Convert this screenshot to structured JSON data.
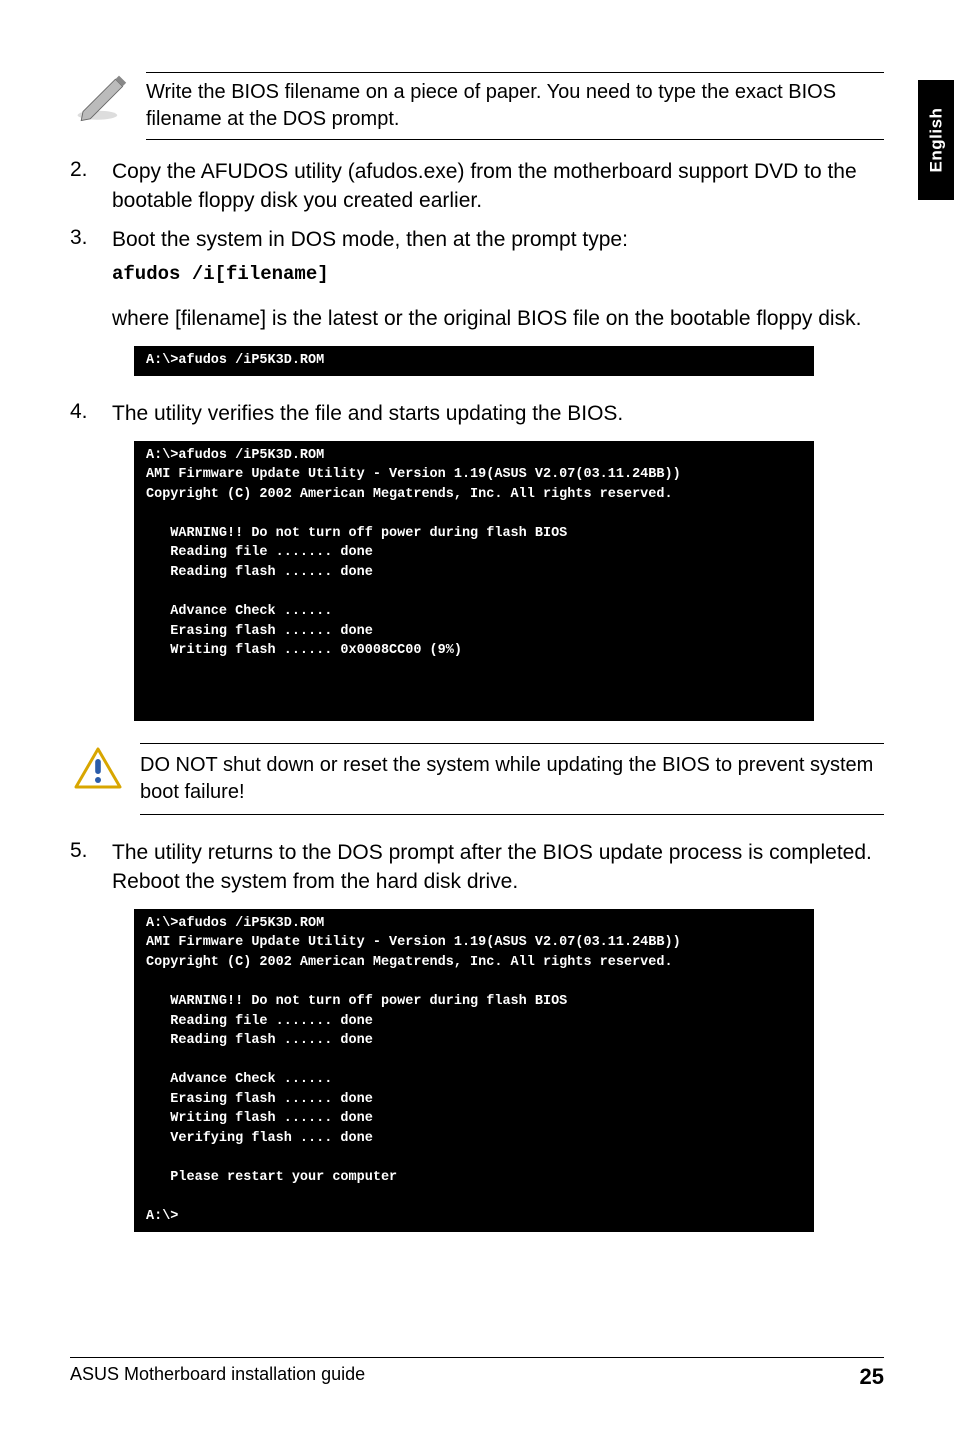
{
  "side_tab": "English",
  "note": {
    "text": "Write the BIOS filename on a piece of paper. You need to type the exact BIOS filename at the DOS prompt."
  },
  "step2": {
    "num": "2.",
    "text": "Copy the AFUDOS utility (afudos.exe) from the motherboard support DVD to the bootable floppy disk you created earlier."
  },
  "step3": {
    "num": "3.",
    "text": "Boot the system in DOS mode, then at the prompt type:",
    "cmd": "afudos /i[filename]",
    "after": "where [filename] is the latest or the original BIOS file on the bootable floppy disk."
  },
  "term1": "A:\\>afudos /iP5K3D.ROM",
  "step4": {
    "num": "4.",
    "text": "The utility verifies the file and starts updating the BIOS."
  },
  "term2": {
    "l1": "A:\\>afudos /iP5K3D.ROM",
    "l2": "AMI Firmware Update Utility - Version 1.19(ASUS V2.07(03.11.24BB))",
    "l3": "Copyright (C) 2002 American Megatrends, Inc. All rights reserved.",
    "l4": "   WARNING!! Do not turn off power during flash BIOS",
    "l5": "   Reading file ....... done",
    "l6": "   Reading flash ...... done",
    "l7": "   Advance Check ......",
    "l8": "   Erasing flash ...... done",
    "l9": "   Writing flash ...... 0x0008CC00 (9%)"
  },
  "caution": {
    "text": "DO NOT shut down or reset the system while updating the BIOS to prevent system boot failure!"
  },
  "step5": {
    "num": "5.",
    "text": "The utility returns to the DOS prompt after the BIOS update process is completed. Reboot the system from the hard disk drive."
  },
  "term3": {
    "l1": "A:\\>afudos /iP5K3D.ROM",
    "l2": "AMI Firmware Update Utility - Version 1.19(ASUS V2.07(03.11.24BB))",
    "l3": "Copyright (C) 2002 American Megatrends, Inc. All rights reserved.",
    "l4": "   WARNING!! Do not turn off power during flash BIOS",
    "l5": "   Reading file ....... done",
    "l6": "   Reading flash ...... done",
    "l7": "   Advance Check ......",
    "l8": "   Erasing flash ...... done",
    "l9": "   Writing flash ...... done",
    "l10": "   Verifying flash .... done",
    "l11": "   Please restart your computer",
    "l12": "A:\\>"
  },
  "footer": {
    "left": "ASUS Motherboard installation guide",
    "page": "25"
  }
}
